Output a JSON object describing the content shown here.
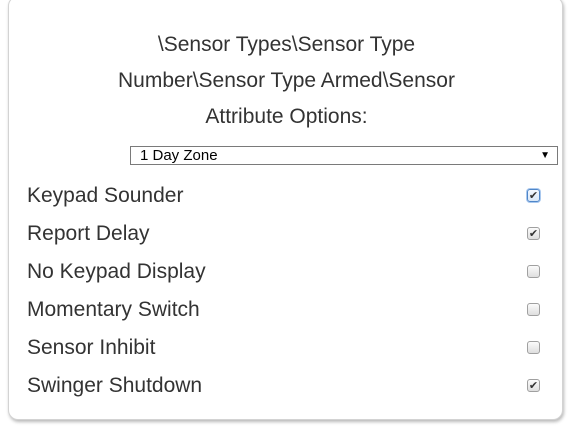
{
  "title_lines": [
    "\\Sensor Types\\Sensor Type",
    "Number\\Sensor Type Armed\\Sensor",
    "Attribute Options:"
  ],
  "select": {
    "value": "1 Day Zone",
    "arrow": "▼"
  },
  "options": [
    {
      "label": "Keypad Sounder",
      "checked": true,
      "mark": "✔",
      "focused": true
    },
    {
      "label": "Report Delay",
      "checked": true,
      "mark": "✔"
    },
    {
      "label": "No Keypad Display",
      "checked": false,
      "mark": ""
    },
    {
      "label": "Momentary Switch",
      "checked": false,
      "mark": ""
    },
    {
      "label": "Sensor Inhibit",
      "checked": false,
      "mark": ""
    },
    {
      "label": "Swinger Shutdown",
      "checked": true,
      "mark": "✔"
    }
  ],
  "colors": {
    "text": "#333333",
    "border": "#d3d3d3",
    "focus": "#4f86c9"
  }
}
